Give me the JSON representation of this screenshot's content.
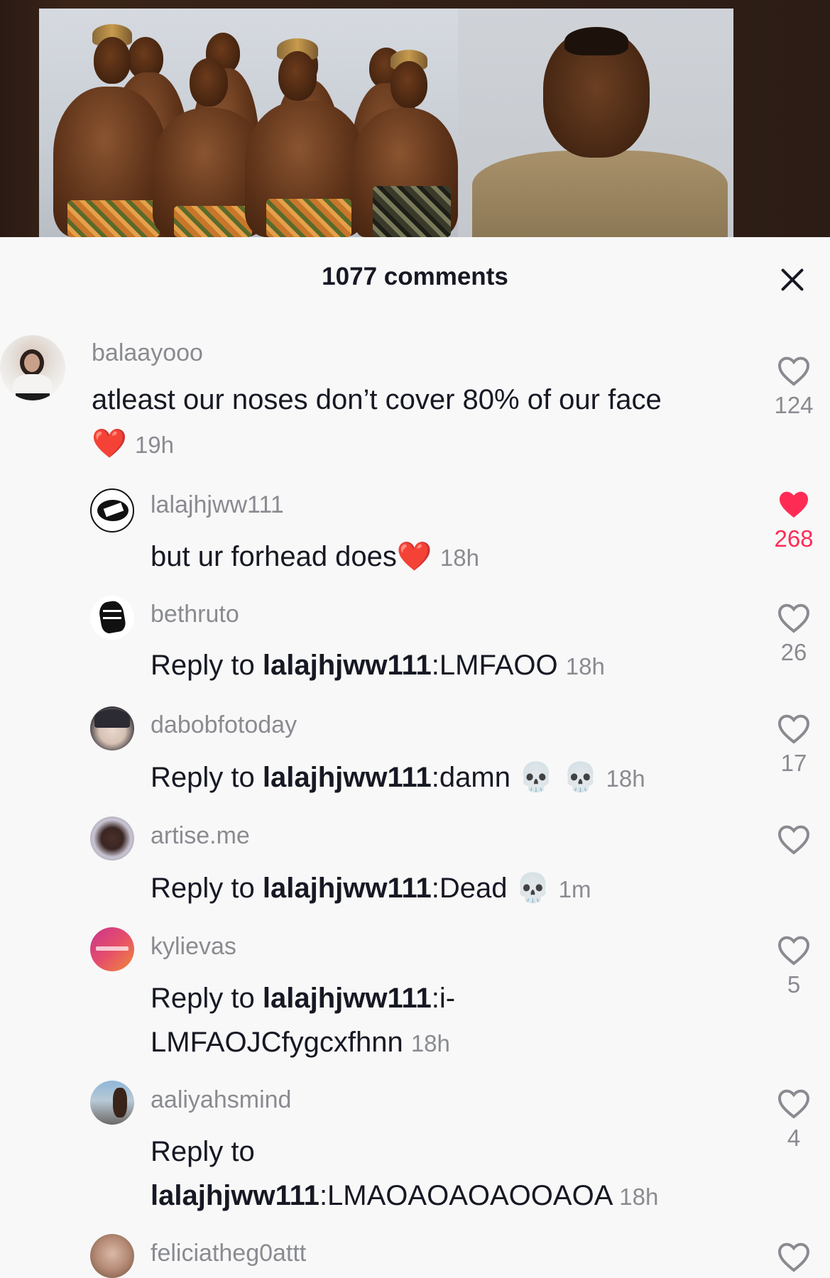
{
  "sheet": {
    "title": "1077 comments"
  },
  "comments": [
    {
      "username": "balaayooo",
      "text": "atleast our noses don’t cover 80% of our face",
      "emoji": "❤️",
      "time": "19h",
      "likes": "124",
      "liked": false
    },
    {
      "username": "lalajhjww111",
      "text": "but ur forhead does",
      "emoji": "❤️",
      "time": "18h",
      "likes": "268",
      "liked": true
    },
    {
      "username": "bethruto",
      "reply_prefix": "Reply to ",
      "reply_to": "lalajhjww111",
      "text": ":LMFAOO",
      "time": "18h",
      "likes": "26",
      "liked": false
    },
    {
      "username": "dabobfotoday",
      "reply_prefix": "Reply to ",
      "reply_to": "lalajhjww111",
      "text": ":damn",
      "emoji": "💀 💀",
      "time": "18h",
      "likes": "17",
      "liked": false
    },
    {
      "username": "artise.me",
      "reply_prefix": "Reply to ",
      "reply_to": "lalajhjww111",
      "text": ":Dead",
      "emoji": "💀",
      "time": "1m",
      "likes": "",
      "liked": false
    },
    {
      "username": "kylievas",
      "reply_prefix": "Reply to ",
      "reply_to": "lalajhjww111",
      "text": ":i-",
      "text2": "LMFAOJCfygcxfhnn",
      "time": "18h",
      "likes": "5",
      "liked": false
    },
    {
      "username": "aaliyahsmind",
      "reply_prefix": "Reply to",
      "reply_to": "lalajhjww111",
      "text": ":LMAOAOAOAOOAOA",
      "time": "18h",
      "likes": "4",
      "liked": false
    },
    {
      "username": "feliciatheg0attt"
    }
  ],
  "icons": {
    "like": "heart-outline-icon",
    "liked": "heart-filled-icon",
    "close": "close-icon"
  },
  "colors": {
    "liked": "#fe2c55",
    "muted": "#8a8b91",
    "text": "#161823"
  }
}
